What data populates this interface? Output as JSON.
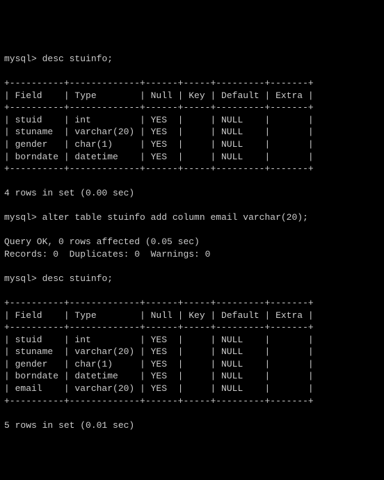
{
  "prompt_label": "mysql>",
  "commands": {
    "desc1": "desc stuinfo;",
    "alter": "alter table stuinfo add column email varchar(20);",
    "desc2": "desc stuinfo;"
  },
  "table1": {
    "border_top": "+----------+-------------+------+-----+---------+-------+",
    "header": "| Field    | Type        | Null | Key | Default | Extra |",
    "border_mid": "+----------+-------------+------+-----+---------+-------+",
    "rows": [
      "| stuid    | int         | YES  |     | NULL    |       |",
      "| stuname  | varchar(20) | YES  |     | NULL    |       |",
      "| gender   | char(1)     | YES  |     | NULL    |       |",
      "| borndate | datetime    | YES  |     | NULL    |       |"
    ],
    "border_bot": "+----------+-------------+------+-----+---------+-------+",
    "footer": "4 rows in set (0.00 sec)"
  },
  "alter_result": {
    "line1": "Query OK, 0 rows affected (0.05 sec)",
    "line2": "Records: 0  Duplicates: 0  Warnings: 0"
  },
  "table2": {
    "border_top": "+----------+-------------+------+-----+---------+-------+",
    "header": "| Field    | Type        | Null | Key | Default | Extra |",
    "border_mid": "+----------+-------------+------+-----+---------+-------+",
    "rows": [
      "| stuid    | int         | YES  |     | NULL    |       |",
      "| stuname  | varchar(20) | YES  |     | NULL    |       |",
      "| gender   | char(1)     | YES  |     | NULL    |       |",
      "| borndate | datetime    | YES  |     | NULL    |       |",
      "| email    | varchar(20) | YES  |     | NULL    |       |"
    ],
    "border_bot": "+----------+-------------+------+-----+---------+-------+",
    "footer": "5 rows in set (0.01 sec)"
  }
}
